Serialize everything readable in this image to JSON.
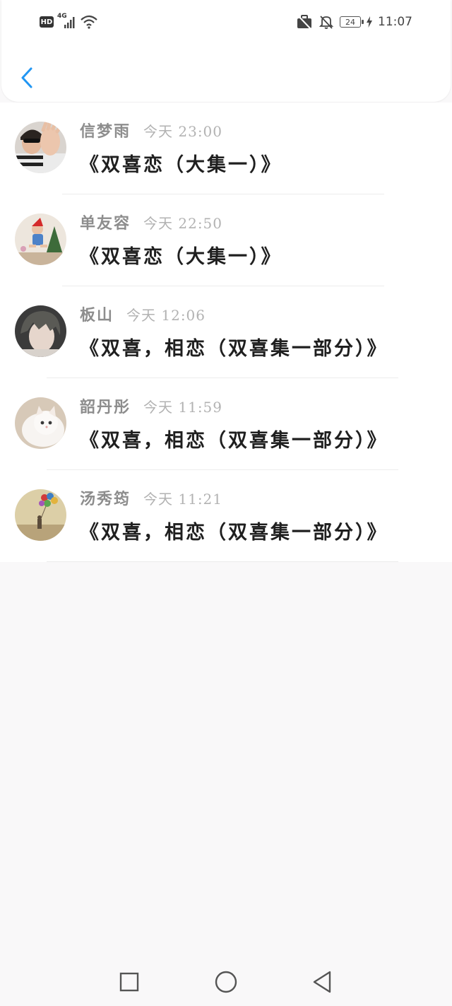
{
  "status_bar": {
    "hd": "HD",
    "network": "4G",
    "battery": "24",
    "time": "11:07"
  },
  "colors": {
    "accent": "#2196f3",
    "username": "#8d8d8d",
    "timestamp": "#b2b2b2",
    "title": "#1f1f1f",
    "background": "#f9f8f9"
  },
  "comments": [
    {
      "user": "信梦雨",
      "time": "今天 23:00",
      "title": "《双喜恋（大集一）》"
    },
    {
      "user": "单友容",
      "time": "今天 22:50",
      "title": "《双喜恋（大集一）》"
    },
    {
      "user": "板山",
      "time": "今天 12:06",
      "title": "《双喜，相恋（双喜集一部分）》"
    },
    {
      "user": "韶丹彤",
      "time": "今天 11:59",
      "title": "《双喜，相恋（双喜集一部分）》"
    },
    {
      "user": "汤秀筠",
      "time": "今天 11:21",
      "title": "《双喜，相恋（双喜集一部分）》"
    }
  ],
  "icons": {
    "back": "chevron-left-icon",
    "nav_recents": "square-icon",
    "nav_home": "circle-icon",
    "nav_back": "triangle-left-icon"
  }
}
